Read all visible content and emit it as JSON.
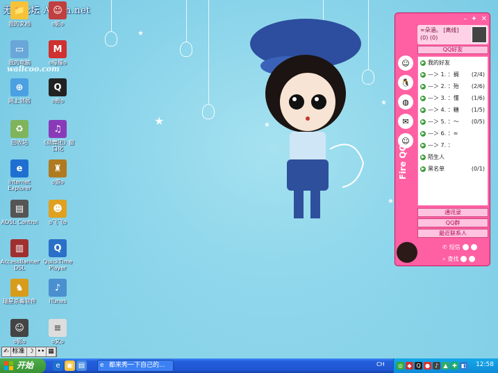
{
  "watermark": "无为论坛 Actcn.net",
  "wallpaper_mark": "wallcoo.com",
  "desktop_icons": [
    {
      "label": "我的文档",
      "icon": "my-documents-icon",
      "color": "#f5c23a"
    },
    {
      "label": "我的电脑",
      "icon": "my-computer-icon",
      "color": "#6aa7d8"
    },
    {
      "label": "网上邻居",
      "icon": "network-places-icon",
      "color": "#4aa0e0"
    },
    {
      "label": "回收站",
      "icon": "recycle-bin-icon",
      "color": "#7fb45c"
    },
    {
      "label": "Internet Explorer",
      "icon": "internet-explorer-icon",
      "color": "#1f6fd0"
    },
    {
      "label": "ADSL Control",
      "icon": "adsl-control-icon",
      "color": "#555555"
    },
    {
      "label": "AccessBanner DSL",
      "icon": "accessbanner-icon",
      "color": "#a03030"
    },
    {
      "label": "瑞星杀毒软件",
      "icon": "rising-antivirus-icon",
      "color": "#d99b1a"
    },
    {
      "label": "o影o",
      "icon": "shortcut-icon",
      "color": "#444444"
    }
  ],
  "desktop_icons_col2": [
    {
      "label": "o影o",
      "icon": "doll-shortcut-icon",
      "color": "#c04040"
    },
    {
      "label": "o缘缘o",
      "icon": "mario-icon",
      "color": "#d03030"
    },
    {
      "label": "o奇o",
      "icon": "qq-penguin-icon",
      "color": "#222222"
    },
    {
      "label": "《劲舞团》窗口化",
      "icon": "audition-icon",
      "color": "#8a3ab8"
    },
    {
      "label": "o游o",
      "icon": "game-icon",
      "color": "#b07a20"
    },
    {
      "label": "o飞飞o",
      "icon": "cartoon-icon",
      "color": "#e0a020"
    },
    {
      "label": "QuickTime Player",
      "icon": "quicktime-icon",
      "color": "#2a70c8"
    },
    {
      "label": "iTunes",
      "icon": "itunes-icon",
      "color": "#4a90d0"
    },
    {
      "label": "o文o",
      "icon": "text-file-icon",
      "color": "#dddddd"
    }
  ],
  "qq": {
    "name": "≈朵涵。",
    "status_label": "[离线]",
    "counts": "(0) (0)",
    "tab": "QQ好友",
    "groups": [
      {
        "label": "我的好友",
        "count": ""
      },
      {
        "label": "—＞ 1. ：搁",
        "count": "(2/4)"
      },
      {
        "label": "—＞ 2. ：殆",
        "count": "(2/6)"
      },
      {
        "label": "—＞ 3. ：懂",
        "count": "(1/6)"
      },
      {
        "label": "—＞ 4. ：糖",
        "count": "(1/5)"
      },
      {
        "label": "—＞ 5. ：～",
        "count": "(0/5)"
      },
      {
        "label": "—＞ 6. ：≈",
        "count": ""
      },
      {
        "label": "—＞ 7. ：",
        "count": ""
      },
      {
        "label": "陌生人",
        "count": ""
      },
      {
        "label": "黑名单",
        "count": "(0/1)"
      }
    ],
    "brand": "Fire QQ",
    "buttons": [
      "通讯录",
      "QQ群",
      "最近联系人"
    ],
    "footer": [
      "短信",
      "查找"
    ]
  },
  "ime": {
    "mode": "标准",
    "punct": "•",
    "full": "••",
    "kb": "▦"
  },
  "taskbar": {
    "start_label": "开始",
    "task_title": "都来秀一下自己的...",
    "lang": "CH",
    "clock": "12:58"
  }
}
